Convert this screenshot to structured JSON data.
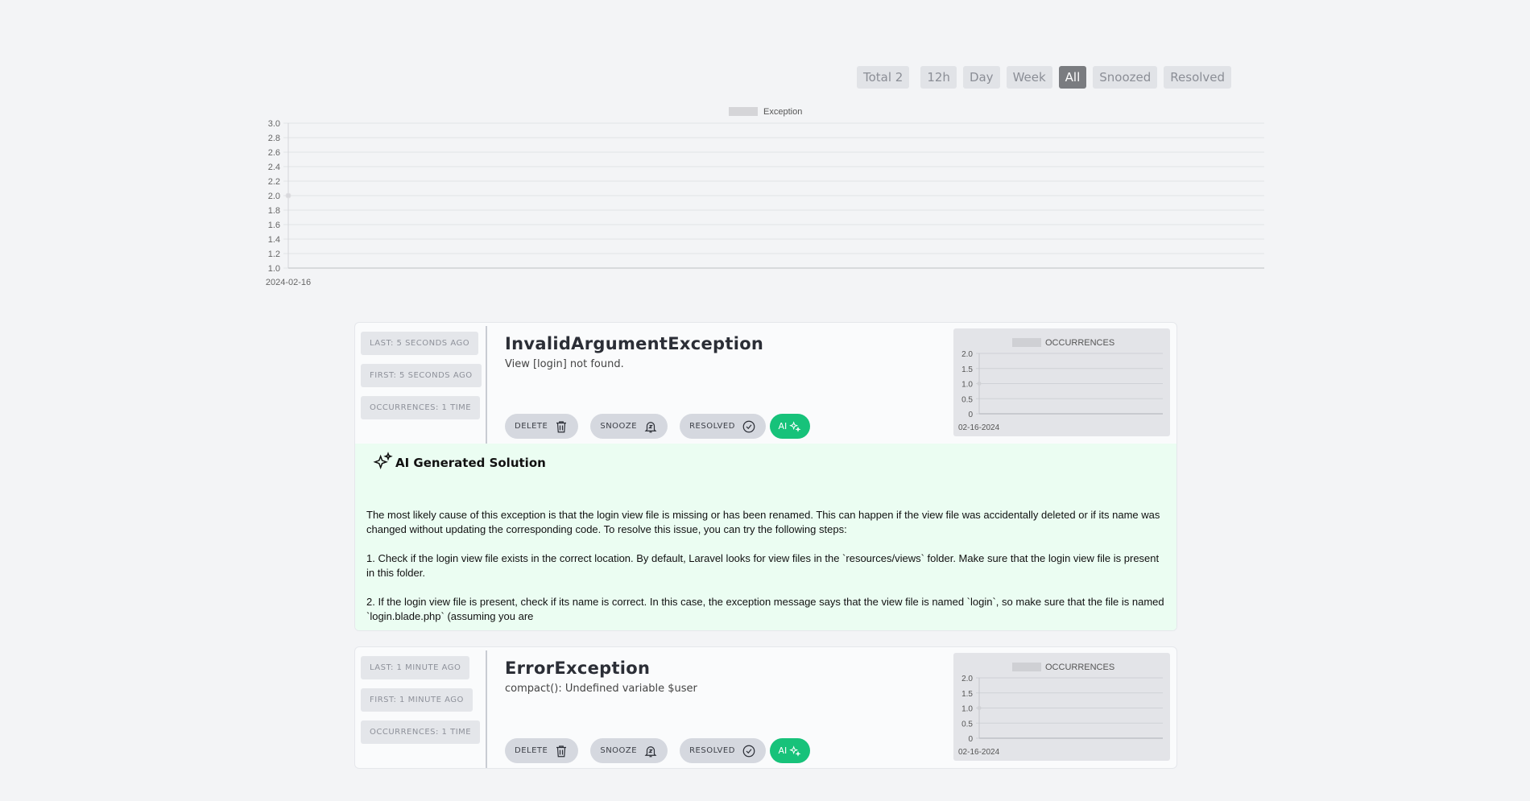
{
  "filters": {
    "total": "Total 2",
    "items": [
      "12h",
      "Day",
      "Week",
      "All",
      "Snoozed",
      "Resolved"
    ],
    "active": "All"
  },
  "chart_data": {
    "type": "line",
    "legend": "Exception",
    "x": [
      "2024-02-16"
    ],
    "series": [
      {
        "name": "Exception",
        "values": [
          2
        ]
      }
    ],
    "ylim": [
      1.0,
      3.0
    ],
    "yticks": [
      "3.0",
      "2.8",
      "2.6",
      "2.4",
      "2.2",
      "2.0",
      "1.8",
      "1.6",
      "1.4",
      "1.2",
      "1.0"
    ],
    "grid": true,
    "legend_position": "top-center"
  },
  "exceptions": [
    {
      "last": "LAST: 5 SECONDS AGO",
      "first": "FIRST: 5 SECONDS AGO",
      "occurrences": "OCCURRENCES: 1 TIME",
      "title": "InvalidArgumentException",
      "message": "View [login] not found.",
      "delete_label": "DELETE",
      "snooze_label": "SNOOZE",
      "resolved_label": "RESOLVED",
      "ai_label": "AI",
      "chart": {
        "legend": "OCCURRENCES",
        "x": [
          "02-16-2024"
        ],
        "values": [
          1
        ],
        "yticks": [
          "2.0",
          "1.5",
          "1.0",
          "0.5",
          "0"
        ],
        "ylim": [
          0,
          2.0
        ]
      },
      "ai_solution": {
        "heading": "AI Generated Solution",
        "paragraphs": [
          "The most likely cause of this exception is that the login view file is missing or has been renamed. This can happen if the view file was accidentally deleted or if its name was changed without updating the corresponding code. To resolve this issue, you can try the following steps:",
          "1. Check if the login view file exists in the correct location. By default, Laravel looks for view files in the `resources/views` folder. Make sure that the login view file is present in this folder.",
          "2. If the login view file is present, check if its name is correct. In this case, the exception message says that the view file is named `login`, so make sure that the file is named `login.blade.php` (assuming you are"
        ]
      }
    },
    {
      "last": "LAST: 1 MINUTE AGO",
      "first": "FIRST: 1 MINUTE AGO",
      "occurrences": "OCCURRENCES: 1 TIME",
      "title": "ErrorException",
      "message": "compact(): Undefined variable $user",
      "delete_label": "DELETE",
      "snooze_label": "SNOOZE",
      "resolved_label": "RESOLVED",
      "ai_label": "AI",
      "chart": {
        "legend": "OCCURRENCES",
        "x": [
          "02-16-2024"
        ],
        "values": [
          1
        ],
        "yticks": [
          "2.0",
          "1.5",
          "1.0",
          "0.5",
          "0"
        ],
        "ylim": [
          0,
          2.0
        ]
      }
    }
  ]
}
